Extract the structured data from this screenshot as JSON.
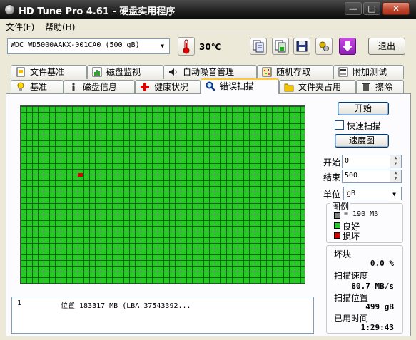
{
  "window": {
    "title": "HD Tune Pro 4.61 - 硬盘实用程序"
  },
  "menu": {
    "file": "文件(F)",
    "help": "帮助(H)"
  },
  "toolbar": {
    "drive": "WDC WD5000AAKX-001CA0 (500 gB)",
    "temperature": "30℃",
    "exit_label": "退出",
    "icons": [
      "copy-text-icon",
      "copy-screenshot-icon",
      "save-icon",
      "options-icon",
      "download-icon"
    ]
  },
  "tabs": {
    "row1": [
      {
        "label": "文件基准",
        "icon": "file-benchmark-icon"
      },
      {
        "label": "磁盘监视",
        "icon": "disk-monitor-icon"
      },
      {
        "label": "自动噪音管理",
        "icon": "speaker-icon"
      },
      {
        "label": "随机存取",
        "icon": "random-access-icon"
      },
      {
        "label": "附加测试",
        "icon": "extra-tests-icon"
      }
    ],
    "row2": [
      {
        "label": "基准",
        "icon": "benchmark-icon"
      },
      {
        "label": "磁盘信息",
        "icon": "disk-info-icon"
      },
      {
        "label": "健康状况",
        "icon": "health-icon"
      },
      {
        "label": "错误扫描",
        "icon": "magnifier-icon",
        "active": true
      },
      {
        "label": "文件夹占用",
        "icon": "folder-icon"
      },
      {
        "label": "擦除",
        "icon": "trash-icon"
      }
    ]
  },
  "scan": {
    "start_label": "开始",
    "quick_scan_label": "快速扫描",
    "quick_scan_checked": false,
    "speed_map_label": "速度图",
    "start_field_label": "开始",
    "start_value": "0",
    "end_field_label": "结束",
    "end_value": "500",
    "unit_label": "单位",
    "unit_value": "gB",
    "legend": {
      "title": "图例",
      "block_size": "= 190 MB",
      "good": "良好",
      "bad": "损坏"
    },
    "stats": {
      "bad_blocks_label": "坏块",
      "bad_blocks_value": "0.0 %",
      "scan_speed_label": "扫描速度",
      "scan_speed_value": "80.7 MB/s",
      "scan_position_label": "扫描位置",
      "scan_position_value": "499 gB",
      "elapsed_label": "已用时间",
      "elapsed_value": "1:29:43"
    },
    "log": {
      "index": "1",
      "text": "位置 183317 MB (LBA 37543392..."
    },
    "colors": {
      "good": "#22cc22",
      "bad": "#d40000",
      "block": "#808080"
    }
  }
}
